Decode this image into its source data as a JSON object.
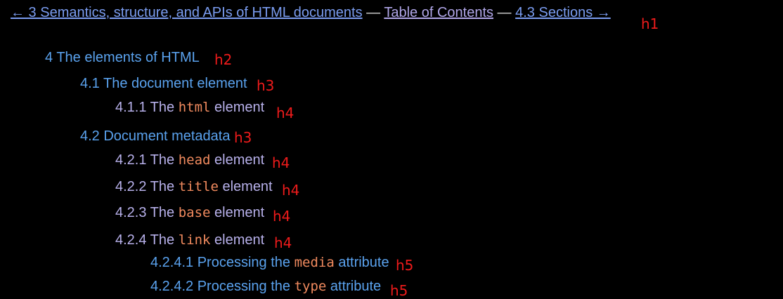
{
  "nav": {
    "prev": "← 3 Semantics, structure, and APIs of HTML documents",
    "sep1": " — ",
    "toc": "Table of Contents",
    "sep2": " — ",
    "next": "4.3 Sections →"
  },
  "outline": {
    "h1_tag": "h1",
    "s4": {
      "text": "4 The elements of HTML",
      "tag": "h2"
    },
    "s4_1": {
      "text": "4.1 The document element",
      "tag": "h3"
    },
    "s4_1_1": {
      "pre": "4.1.1 The ",
      "code": "html",
      "post": " element",
      "tag": "h4"
    },
    "s4_2": {
      "text": "4.2 Document metadata",
      "tag": "h3"
    },
    "s4_2_1": {
      "pre": "4.2.1 The ",
      "code": "head",
      "post": " element",
      "tag": "h4"
    },
    "s4_2_2": {
      "pre": "4.2.2 The ",
      "code": "title",
      "post": " element",
      "tag": "h4"
    },
    "s4_2_3": {
      "pre": "4.2.3 The ",
      "code": "base",
      "post": " element",
      "tag": "h4"
    },
    "s4_2_4": {
      "pre": "4.2.4 The ",
      "code": "link",
      "post": " element",
      "tag": "h4"
    },
    "s4_2_4_1": {
      "pre": "4.2.4.1 Processing the ",
      "code": "media",
      "post": " attribute",
      "tag": "h5"
    },
    "s4_2_4_2": {
      "pre": "4.2.4.2 Processing the ",
      "code": "type",
      "post": " attribute",
      "tag": "h5"
    }
  }
}
